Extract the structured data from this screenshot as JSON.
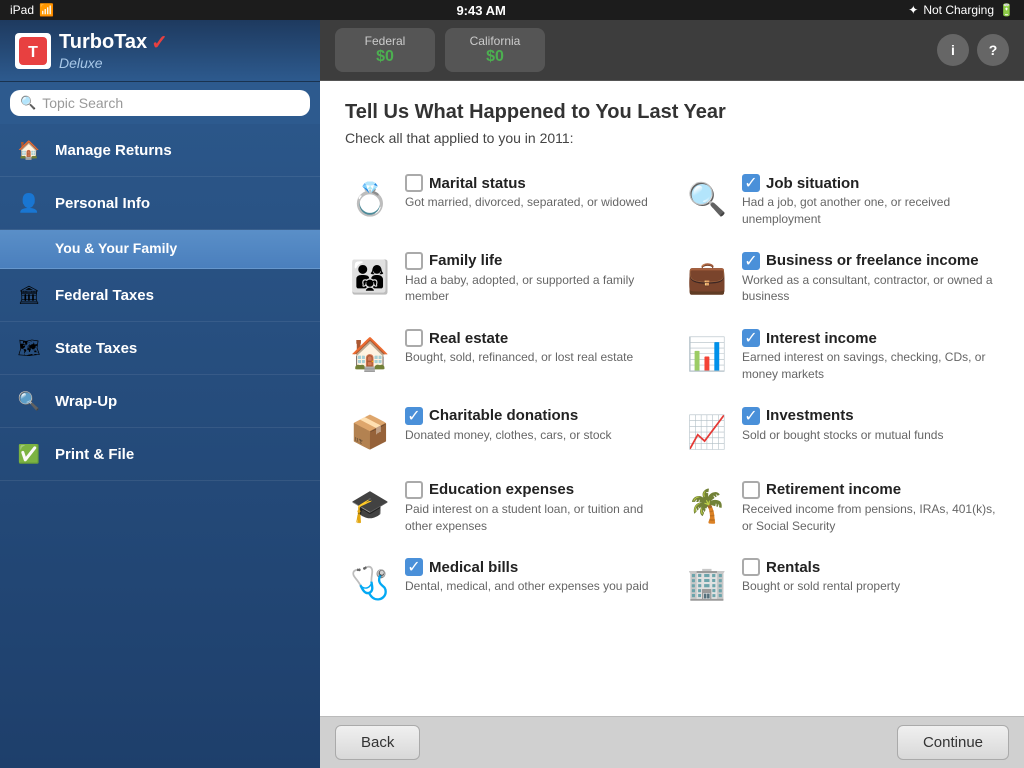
{
  "statusBar": {
    "left": "iPad ✦",
    "center": "9:43 AM",
    "right_bt": "✦ Not Charging"
  },
  "logo": {
    "brand": "TurboTax",
    "checkmark": "✓",
    "edition": "Deluxe"
  },
  "search": {
    "placeholder": "Topic Search"
  },
  "nav": {
    "items": [
      {
        "id": "manage-returns",
        "label": "Manage Returns",
        "icon": "🏠"
      },
      {
        "id": "personal-info",
        "label": "Personal Info",
        "icon": "👤"
      },
      {
        "id": "you-family",
        "label": "You & Your Family",
        "sub": true,
        "active": true
      },
      {
        "id": "federal-taxes",
        "label": "Federal Taxes",
        "icon": "🏛"
      },
      {
        "id": "state-taxes",
        "label": "State Taxes",
        "icon": "🗺"
      },
      {
        "id": "wrap-up",
        "label": "Wrap-Up",
        "icon": "🔍"
      },
      {
        "id": "print-file",
        "label": "Print & File",
        "icon": "✅"
      }
    ]
  },
  "tabs": {
    "federal": {
      "label": "Federal",
      "amount": "$0"
    },
    "california": {
      "label": "California",
      "amount": "$0"
    }
  },
  "page": {
    "title": "Tell Us What Happened to You Last Year",
    "subtitle": "Check all that applied to you in 2011:"
  },
  "lifeEvents": [
    {
      "id": "marital-status",
      "icon": "💍",
      "title": "Marital status",
      "desc": "Got married, divorced, separated, or widowed",
      "checked": false
    },
    {
      "id": "job-situation",
      "icon": "🔍",
      "title": "Job situation",
      "desc": "Had a job, got another one, or received unemployment",
      "checked": true
    },
    {
      "id": "family-life",
      "icon": "👨‍👩‍👧",
      "title": "Family life",
      "desc": "Had a baby, adopted, or supported a family member",
      "checked": false
    },
    {
      "id": "business-freelance",
      "icon": "💼",
      "title": "Business or freelance income",
      "desc": "Worked as a consultant, contractor, or owned a business",
      "checked": true
    },
    {
      "id": "real-estate",
      "icon": "🏠",
      "title": "Real estate",
      "desc": "Bought, sold, refinanced, or lost real estate",
      "checked": false
    },
    {
      "id": "interest-income",
      "icon": "📊",
      "title": "Interest income",
      "desc": "Earned interest on savings, checking, CDs, or money markets",
      "checked": true
    },
    {
      "id": "charitable-donations",
      "icon": "📦",
      "title": "Charitable donations",
      "desc": "Donated money, clothes, cars, or stock",
      "checked": true
    },
    {
      "id": "investments",
      "icon": "📈",
      "title": "Investments",
      "desc": "Sold or bought stocks or mutual funds",
      "checked": true
    },
    {
      "id": "education-expenses",
      "icon": "🎓",
      "title": "Education expenses",
      "desc": "Paid interest on a student loan, or tuition and other expenses",
      "checked": false
    },
    {
      "id": "retirement-income",
      "icon": "🌴",
      "title": "Retirement income",
      "desc": "Received income from pensions, IRAs, 401(k)s, or Social Security",
      "checked": false
    },
    {
      "id": "medical-bills",
      "icon": "🩺",
      "title": "Medical bills",
      "desc": "Dental, medical, and other expenses you paid",
      "checked": true
    },
    {
      "id": "rentals",
      "icon": "🏢",
      "title": "Rentals",
      "desc": "Bought or sold rental property",
      "checked": false
    }
  ],
  "footer": {
    "back": "Back",
    "continue": "Continue"
  }
}
